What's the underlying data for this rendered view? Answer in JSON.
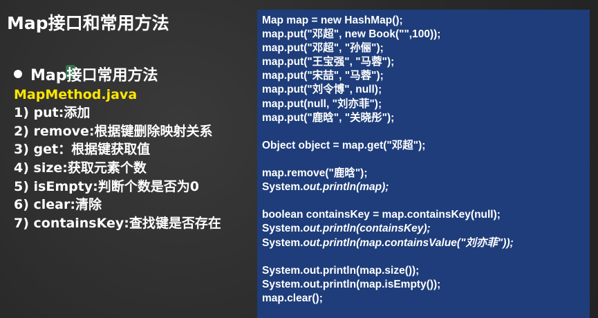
{
  "title": "Map接口和常用方法",
  "section": {
    "heading": "Map接口常用方法",
    "file": "MapMethod.java",
    "methods": [
      "1) put:添加",
      "2) remove:根据键删除映射关系",
      "3) get：根据键获取值",
      "4) size:获取元素个数",
      "5) isEmpty:判断个数是否为0",
      "6) clear:清除",
      "7) containsKey:查找键是否存在"
    ]
  },
  "code": {
    "l1": "Map map = new HashMap();",
    "l2": "map.put(\"邓超\", new Book(\"\",100));",
    "l3": "map.put(\"邓超\", \"孙俪\");",
    "l4": "map.put(\"王宝强\", \"马蓉\");",
    "l5": "map.put(\"宋喆\", \"马蓉\");",
    "l6": "map.put(\"刘令博\", null);",
    "l7": "map.put(null, \"刘亦菲\");",
    "l8": "map.put(\"鹿晗\", \"关晓彤\");",
    "l10": "Object object = map.get(\"邓超\");",
    "l12": "map.remove(\"鹿晗\");",
    "l13a": "System.",
    "l13b": "out.println(map);",
    "l15": "boolean containsKey = map.containsKey(null);",
    "l16a": "System.",
    "l16b": "out.println(containsKey);",
    "l17a": "System.",
    "l17b": "out.println(map.containsValue(\"刘亦菲\"));",
    "l19": "System.out.println(map.size());",
    "l20": "System.out.println(map.isEmpty());",
    "l21": "map.clear();"
  },
  "colors": {
    "background": "#2b2b2b",
    "code_panel": "#1e3d7a",
    "file_name": "#ffe600",
    "text": "#ffffff"
  }
}
